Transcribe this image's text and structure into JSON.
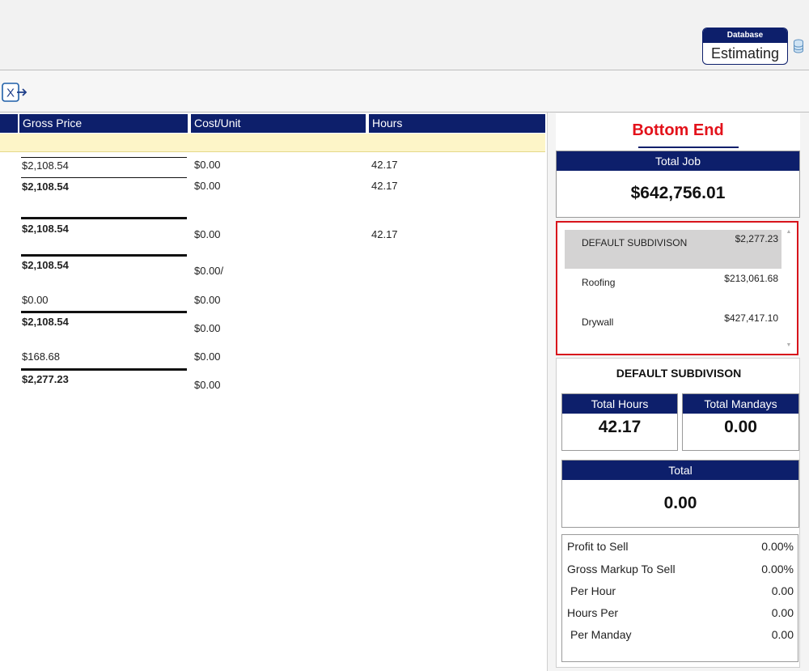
{
  "header": {
    "database_label": "Database",
    "database_value": "Estimating",
    "database_icon": "database-icon"
  },
  "toolbar": {
    "export_icon": "export-excel-icon",
    "export_glyph": "X"
  },
  "grid": {
    "columns": [
      "Gross Price",
      "Cost/Unit",
      "Hours"
    ],
    "rows": [
      {
        "gross": "$2,108.54",
        "cost": "$0.00",
        "hours": "42.17"
      },
      {
        "gross": "$2,108.54",
        "cost": "$0.00",
        "hours": "42.17"
      },
      {
        "gross": "$2,108.54",
        "cost": "$0.00",
        "hours": "42.17"
      },
      {
        "gross": "$2,108.54",
        "cost": "$0.00/",
        "hours": ""
      },
      {
        "gross": "$0.00",
        "cost": "$0.00",
        "hours": ""
      },
      {
        "gross": "$2,108.54",
        "cost": "$0.00",
        "hours": ""
      },
      {
        "gross": "$168.68",
        "cost": "$0.00",
        "hours": ""
      },
      {
        "gross": "$2,277.23",
        "cost": "$0.00",
        "hours": ""
      }
    ]
  },
  "bottom_end": {
    "title": "Bottom End",
    "total_job_label": "Total Job",
    "total_job_value": "$642,756.01",
    "subdivisions": [
      {
        "name": "DEFAULT SUBDIVISON",
        "amount": "$2,277.23",
        "selected": true
      },
      {
        "name": "Roofing",
        "amount": "$213,061.68",
        "selected": false
      },
      {
        "name": "Drywall",
        "amount": "$427,417.10",
        "selected": false
      }
    ],
    "detail": {
      "title": "DEFAULT SUBDIVISON",
      "total_hours_label": "Total Hours",
      "total_hours_value": "42.17",
      "total_mandays_label": "Total Mandays",
      "total_mandays_value": "0.00",
      "total_label": "Total",
      "total_value": "0.00",
      "metrics": [
        {
          "label": "Profit to Sell",
          "value": "0.00%"
        },
        {
          "label": "Gross Markup To Sell",
          "value": "0.00%"
        },
        {
          "label": "Per Hour",
          "value": "0.00"
        },
        {
          "label": "Hours Per",
          "value": "0.00"
        },
        {
          "label": "Per Manday",
          "value": "0.00"
        }
      ]
    }
  },
  "colors": {
    "header_navy": "#0d1f6b",
    "title_red": "#e3121b",
    "selection_border": "#d8141c",
    "group_row_yellow": "#fdf5c8"
  }
}
